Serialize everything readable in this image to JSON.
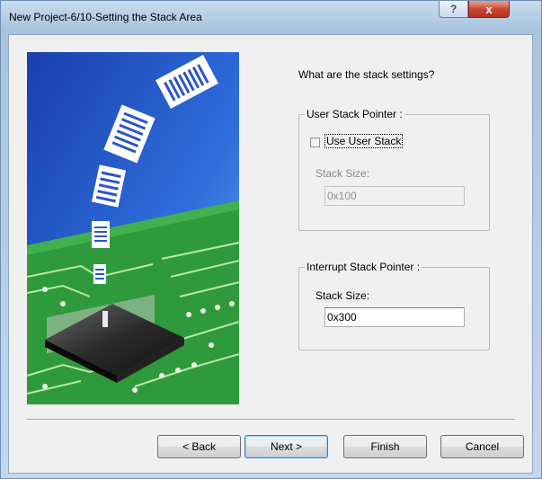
{
  "window": {
    "title": "New Project-6/10-Setting the Stack Area"
  },
  "titlebar_buttons": {
    "help_glyph": "?",
    "close_glyph": "x"
  },
  "dialog": {
    "question": "What are the stack settings?",
    "user_stack_group": {
      "legend": "User Stack Pointer :",
      "checkbox_label": "Use User Stack",
      "checked": false,
      "size_label": "Stack Size:",
      "size_value": "0x100",
      "enabled": false
    },
    "interrupt_stack_group": {
      "legend": "Interrupt Stack Pointer :",
      "size_label": "Stack Size:",
      "size_value": "0x300",
      "enabled": true
    }
  },
  "buttons": {
    "back": "< Back",
    "next": "Next >",
    "finish": "Finish",
    "cancel": "Cancel"
  },
  "icons": [
    "help-icon",
    "close-icon",
    "wizard-illustration"
  ],
  "colors": {
    "title_gradient_top": "#c9dbee",
    "illustration_sky": "#1f56c8",
    "pcb_green": "#2f9a3c",
    "close_red": "#c94a33"
  }
}
